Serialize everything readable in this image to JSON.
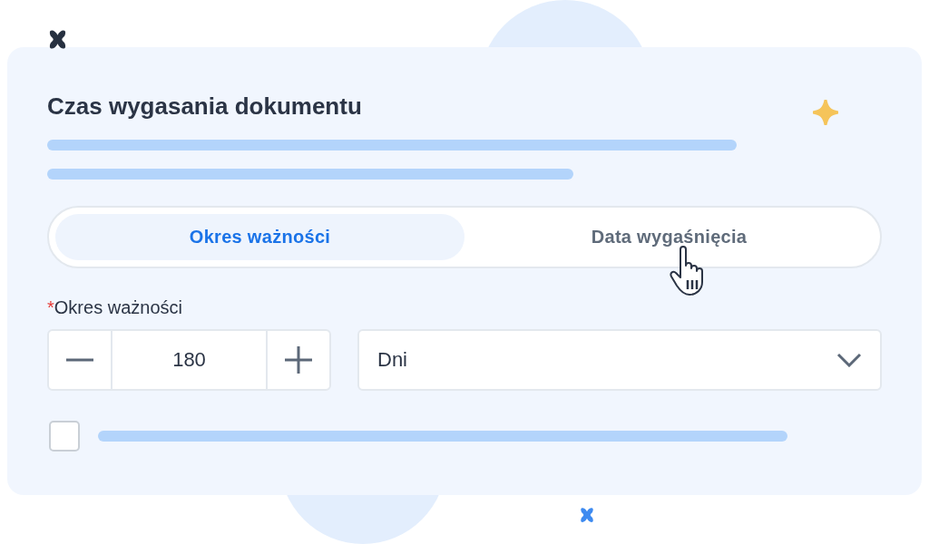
{
  "title": "Czas wygasania dokumentu",
  "tabs": [
    {
      "label": "Okres ważności",
      "selected": true
    },
    {
      "label": "Data wygaśnięcia",
      "selected": false
    }
  ],
  "period": {
    "required_mark": "*",
    "label": "Okres ważności",
    "value": "180"
  },
  "unit": {
    "value": "Dni"
  },
  "checkbox": {
    "checked": false
  }
}
